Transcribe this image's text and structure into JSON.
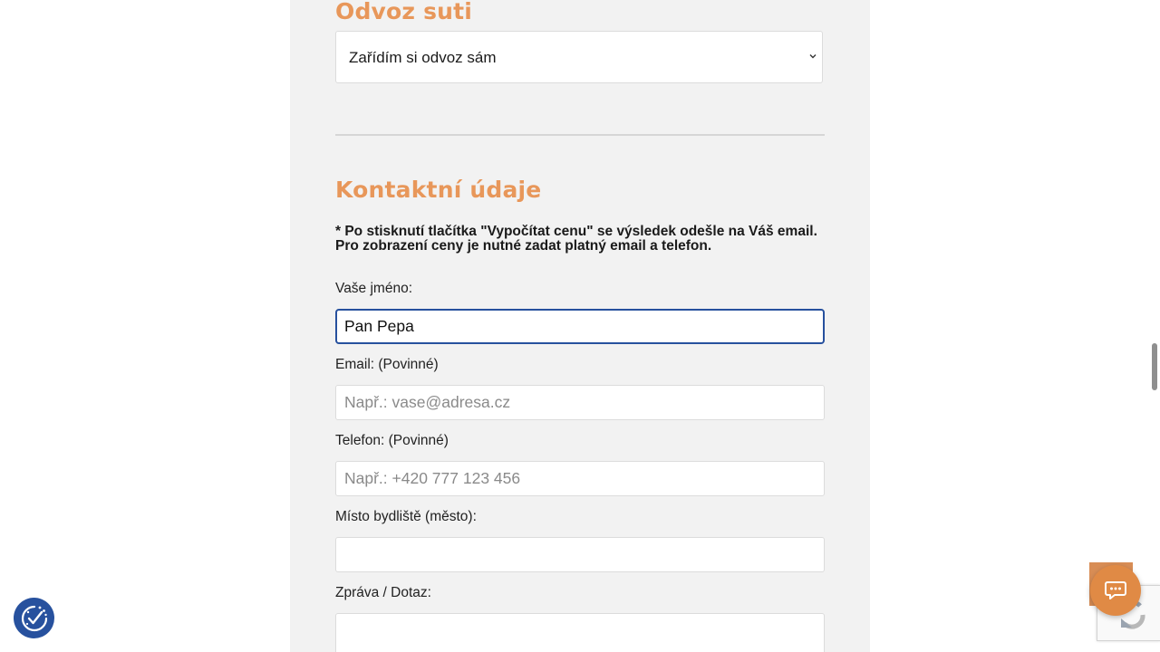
{
  "disposal": {
    "title": "Odvoz suti",
    "selected": "Zařídím si odvoz sám"
  },
  "contact": {
    "title": "Kontaktní údaje",
    "notice": "* Po stisknutí tlačítka \"Vypočítat cenu\" se výsledek odešle na Váš email. Pro zobrazení ceny je nutné zadat platný email a telefon."
  },
  "fields": {
    "name": {
      "label": "Vaše jméno:",
      "value": "Pan Pepa"
    },
    "email": {
      "label": "Email: (Povinné)",
      "placeholder": "Např.: vase@adresa.cz"
    },
    "phone": {
      "label": "Telefon: (Povinné)",
      "placeholder": "Např.: +420 777 123 456"
    },
    "city": {
      "label": "Místo bydliště (město):",
      "value": ""
    },
    "message": {
      "label": "Zpráva / Dotaz:"
    }
  },
  "widgets": {
    "cookie_icon": "cookie-consent-icon",
    "chat_icon": "chat-bubble-icon",
    "recaptcha_icon": "recaptcha-icon"
  },
  "colors": {
    "accent": "#e8975a",
    "focus": "#27519e",
    "chat": "#e08a45",
    "panel": "#f2f2f2"
  }
}
